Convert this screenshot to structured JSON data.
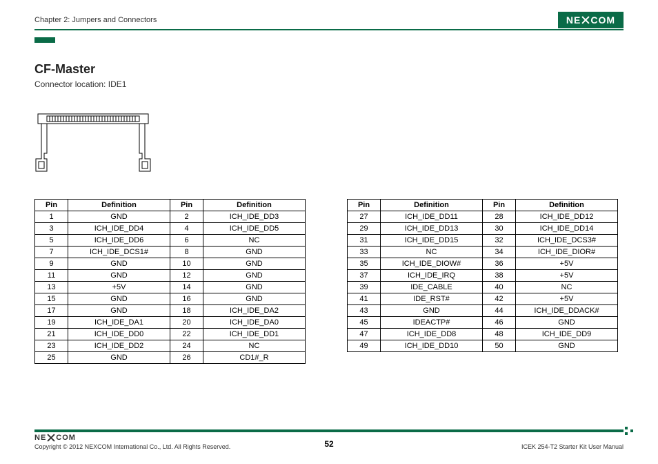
{
  "header": {
    "chapter": "Chapter 2: Jumpers and Connectors",
    "logo_text_left": "NE",
    "logo_text_right": "COM"
  },
  "section": {
    "title": "CF-Master",
    "subtitle": "Connector location: IDE1"
  },
  "table_headers": {
    "pin": "Pin",
    "definition": "Definition"
  },
  "pins_left": [
    {
      "p1": "1",
      "d1": "GND",
      "p2": "2",
      "d2": "ICH_IDE_DD3"
    },
    {
      "p1": "3",
      "d1": "ICH_IDE_DD4",
      "p2": "4",
      "d2": "ICH_IDE_DD5"
    },
    {
      "p1": "5",
      "d1": "ICH_IDE_DD6",
      "p2": "6",
      "d2": "NC"
    },
    {
      "p1": "7",
      "d1": "ICH_IDE_DCS1#",
      "p2": "8",
      "d2": "GND"
    },
    {
      "p1": "9",
      "d1": "GND",
      "p2": "10",
      "d2": "GND"
    },
    {
      "p1": "11",
      "d1": "GND",
      "p2": "12",
      "d2": "GND"
    },
    {
      "p1": "13",
      "d1": "+5V",
      "p2": "14",
      "d2": "GND"
    },
    {
      "p1": "15",
      "d1": "GND",
      "p2": "16",
      "d2": "GND"
    },
    {
      "p1": "17",
      "d1": "GND",
      "p2": "18",
      "d2": "ICH_IDE_DA2"
    },
    {
      "p1": "19",
      "d1": "ICH_IDE_DA1",
      "p2": "20",
      "d2": "ICH_IDE_DA0"
    },
    {
      "p1": "21",
      "d1": "ICH_IDE_DD0",
      "p2": "22",
      "d2": "ICH_IDE_DD1"
    },
    {
      "p1": "23",
      "d1": "ICH_IDE_DD2",
      "p2": "24",
      "d2": "NC"
    },
    {
      "p1": "25",
      "d1": "GND",
      "p2": "26",
      "d2": "CD1#_R"
    }
  ],
  "pins_right": [
    {
      "p1": "27",
      "d1": "ICH_IDE_DD11",
      "p2": "28",
      "d2": "ICH_IDE_DD12"
    },
    {
      "p1": "29",
      "d1": "ICH_IDE_DD13",
      "p2": "30",
      "d2": "ICH_IDE_DD14"
    },
    {
      "p1": "31",
      "d1": "ICH_IDE_DD15",
      "p2": "32",
      "d2": "ICH_IDE_DCS3#"
    },
    {
      "p1": "33",
      "d1": "NC",
      "p2": "34",
      "d2": "ICH_IDE_DIOR#"
    },
    {
      "p1": "35",
      "d1": "ICH_IDE_DIOW#",
      "p2": "36",
      "d2": "+5V"
    },
    {
      "p1": "37",
      "d1": "ICH_IDE_IRQ",
      "p2": "38",
      "d2": "+5V"
    },
    {
      "p1": "39",
      "d1": "IDE_CABLE",
      "p2": "40",
      "d2": "NC"
    },
    {
      "p1": "41",
      "d1": "IDE_RST#",
      "p2": "42",
      "d2": "+5V"
    },
    {
      "p1": "43",
      "d1": "GND",
      "p2": "44",
      "d2": "ICH_IDE_DDACK#"
    },
    {
      "p1": "45",
      "d1": "IDEACTP#",
      "p2": "46",
      "d2": "GND"
    },
    {
      "p1": "47",
      "d1": "ICH_IDE_DD8",
      "p2": "48",
      "d2": "ICH_IDE_DD9"
    },
    {
      "p1": "49",
      "d1": "ICH_IDE_DD10",
      "p2": "50",
      "d2": "GND"
    }
  ],
  "footer": {
    "copyright": "Copyright © 2012 NEXCOM International Co., Ltd. All Rights Reserved.",
    "page_number": "52",
    "manual": "ICEK 254-T2 Starter Kit User Manual",
    "logo_text_left": "NE",
    "logo_text_right": "COM"
  }
}
